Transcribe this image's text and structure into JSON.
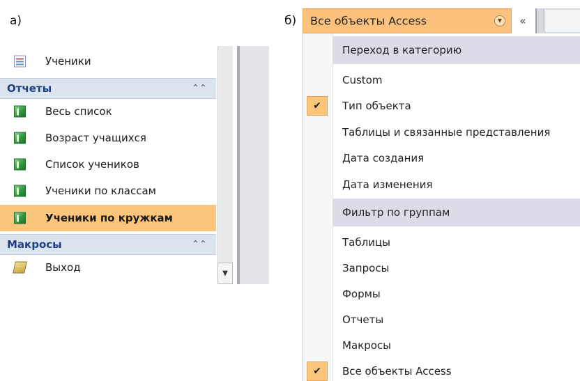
{
  "labels": {
    "a": "а)",
    "b": "б)"
  },
  "panel_a": {
    "top_item": {
      "label": "Ученики",
      "icon": "form-icon"
    },
    "groups": [
      {
        "title": "Отчеты",
        "collapse_glyph": "⌃⌃",
        "items": [
          {
            "label": "Весь список",
            "icon": "report-icon",
            "selected": false
          },
          {
            "label": "Возраст учащихся",
            "icon": "report-icon",
            "selected": false
          },
          {
            "label": "Список учеников",
            "icon": "report-icon",
            "selected": false
          },
          {
            "label": "Ученики по классам",
            "icon": "report-icon",
            "selected": false
          },
          {
            "label": "Ученики по кружкам",
            "icon": "report-icon",
            "selected": true
          }
        ]
      },
      {
        "title": "Макросы",
        "collapse_glyph": "⌃⌃",
        "items": [
          {
            "label": "Выход",
            "icon": "macro-icon",
            "selected": false
          }
        ]
      }
    ],
    "scroll_down_glyph": "▼"
  },
  "panel_b": {
    "header_title": "Все объекты Access",
    "dropdown_glyph": "▼",
    "collapse_glyph": "«",
    "sections": {
      "category_header": "Переход в категорию",
      "category_items": [
        {
          "label": "Custom",
          "checked": false
        },
        {
          "label": "Тип объекта",
          "checked": true
        },
        {
          "label": "Таблицы и связанные представления",
          "checked": false
        },
        {
          "label": "Дата создания",
          "checked": false
        },
        {
          "label": "Дата изменения",
          "checked": false
        }
      ],
      "filter_header": "Фильтр по группам",
      "filter_items": [
        {
          "label": "Таблицы",
          "checked": false
        },
        {
          "label": "Запросы",
          "checked": false
        },
        {
          "label": "Формы",
          "checked": false
        },
        {
          "label": "Отчеты",
          "checked": false
        },
        {
          "label": "Макросы",
          "checked": false
        },
        {
          "label": "Все объекты Access",
          "checked": true
        }
      ]
    },
    "check_glyph": "✔"
  },
  "colors": {
    "selection_orange": "#fbc57c",
    "group_header_bg": "#dbe3ee",
    "group_title": "#1d3f85",
    "menu_header_bg": "#dcdce8"
  }
}
